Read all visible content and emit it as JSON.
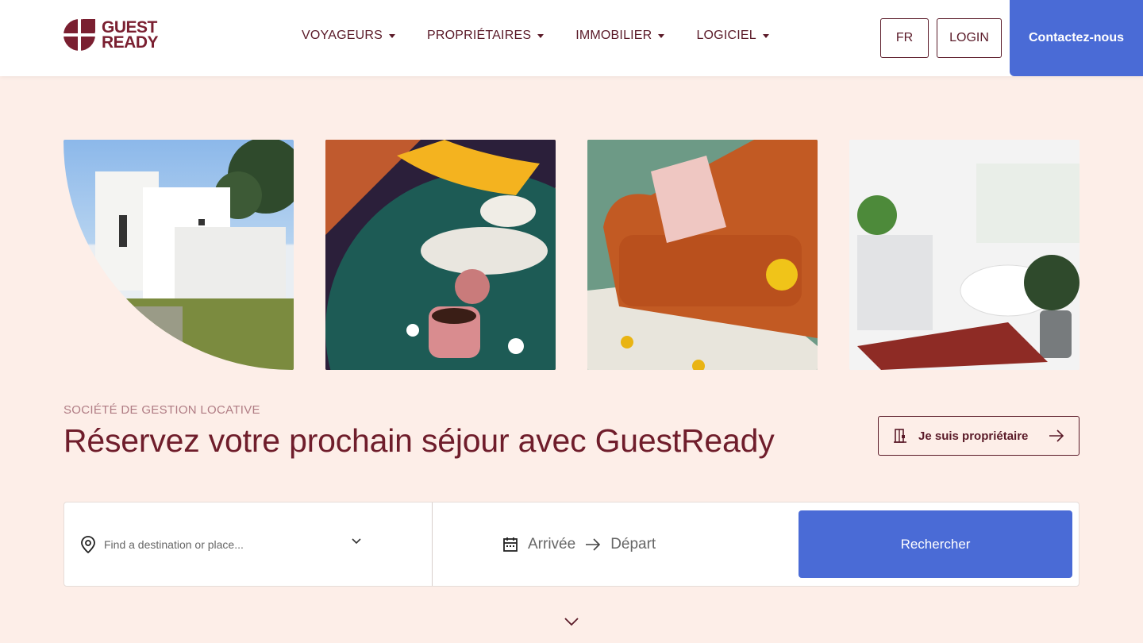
{
  "brand": {
    "line1": "GUEST",
    "line2": "READY"
  },
  "nav": [
    {
      "label": "VOYAGEURS"
    },
    {
      "label": "PROPRIÉTAIRES"
    },
    {
      "label": "IMMOBILIER"
    },
    {
      "label": "LOGICIEL"
    }
  ],
  "header_buttons": {
    "language": "FR",
    "login": "LOGIN",
    "contact": "Contactez-nous"
  },
  "hero": {
    "eyebrow": "SOCIÉTÉ DE GESTION LOCATIVE",
    "title": "Réservez votre prochain séjour avec GuestReady",
    "owner_button": "Je suis propriétaire"
  },
  "search": {
    "destination_placeholder": "Find a destination or place...",
    "arrival": "Arrivée",
    "departure": "Départ",
    "submit": "Rechercher"
  },
  "colors": {
    "brand": "#6f1d2b",
    "accent": "#4a6bd6",
    "background": "#fdeee8"
  },
  "icons": [
    "location-pin-icon",
    "chevron-down-icon",
    "calendar-icon",
    "arrow-right-icon",
    "building-icon"
  ]
}
